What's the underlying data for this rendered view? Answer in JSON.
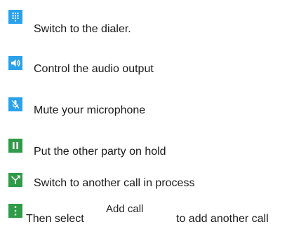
{
  "colors": {
    "icon_blue": "#2aa1ea",
    "icon_green": "#2f9a47",
    "text": "#1a1a1a"
  },
  "instructions": [
    {
      "icon": "dialpad-icon",
      "text": "Switch to the dialer."
    },
    {
      "icon": "speaker-icon",
      "text": "Control the audio output"
    },
    {
      "icon": "mic-off-icon",
      "text": "Mute your microphone"
    },
    {
      "icon": "pause-icon",
      "text": "Put the other party on hold"
    },
    {
      "icon": "swap-call-icon",
      "text": "Switch to another call in process"
    },
    {
      "icon": "more-menu-icon",
      "text_before": "Then select",
      "button_label": "Add call",
      "text_after": "to add another call"
    }
  ]
}
